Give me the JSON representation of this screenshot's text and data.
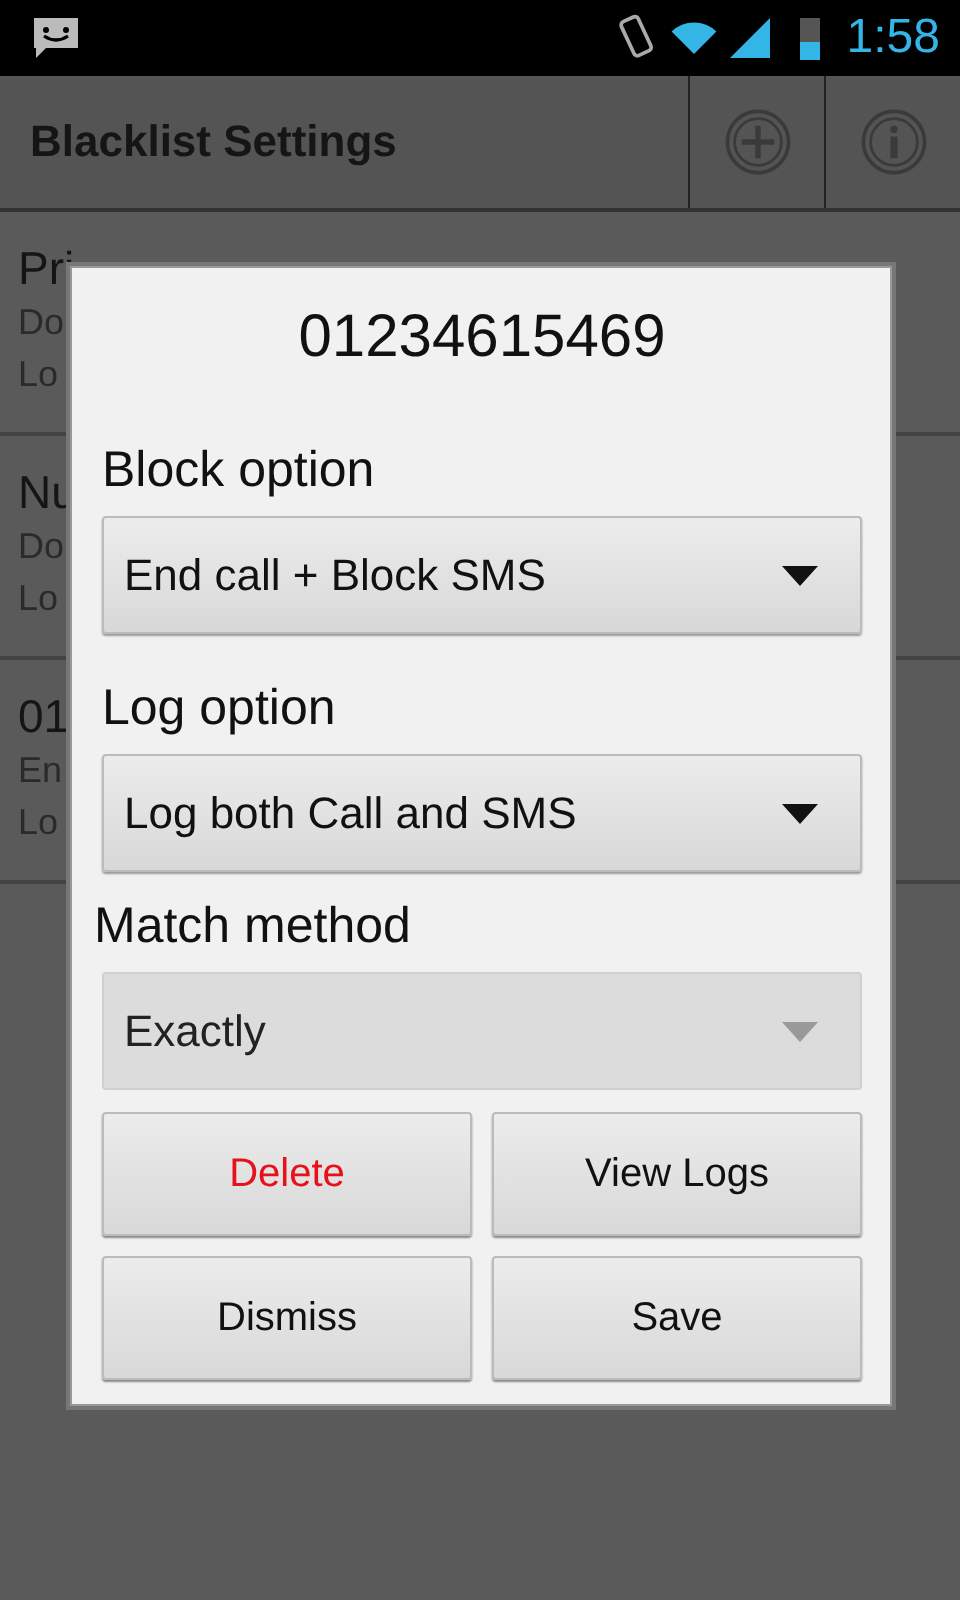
{
  "status_bar": {
    "time": "1:58"
  },
  "action_bar": {
    "title": "Blacklist Settings"
  },
  "list": [
    {
      "title": "Pri",
      "line_1": "Do",
      "line_2": "Lo"
    },
    {
      "title": "Nu",
      "line_1": "Do",
      "line_2": "Lo"
    },
    {
      "title": "01",
      "line_1": "En",
      "line_2": "Lo"
    }
  ],
  "dialog": {
    "title": "01234615469",
    "fields": [
      {
        "label": "Block option",
        "value": "End call + Block SMS",
        "disabled": false
      },
      {
        "label": "Log option",
        "value": "Log both Call and SMS",
        "disabled": false
      },
      {
        "label": "Match method",
        "value": "Exactly",
        "disabled": true
      }
    ],
    "buttons": [
      {
        "label": "Delete",
        "kind": "danger"
      },
      {
        "label": "View Logs",
        "kind": "normal"
      },
      {
        "label": "Dismiss",
        "kind": "normal"
      },
      {
        "label": "Save",
        "kind": "normal"
      }
    ]
  }
}
